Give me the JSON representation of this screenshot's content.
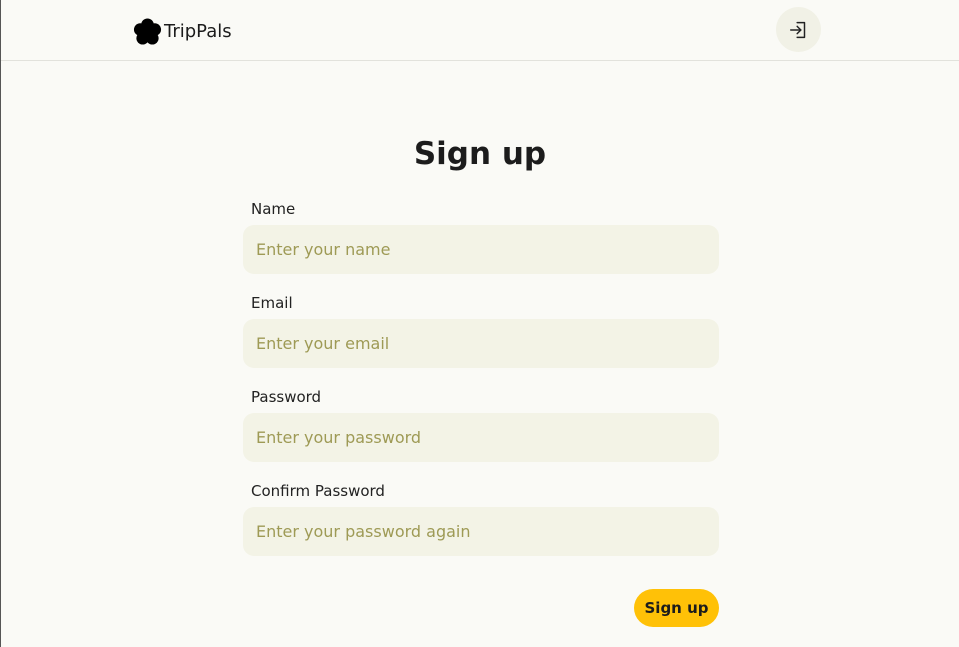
{
  "header": {
    "brand_name": "TripPals",
    "logo_icon": "flower-icon",
    "login_icon": "login-icon"
  },
  "form": {
    "title": "Sign up",
    "fields": [
      {
        "label": "Name",
        "placeholder": "Enter your name",
        "value": ""
      },
      {
        "label": "Email",
        "placeholder": "Enter your email",
        "value": ""
      },
      {
        "label": "Password",
        "placeholder": "Enter your password",
        "value": ""
      },
      {
        "label": "Confirm Password",
        "placeholder": "Enter your password again",
        "value": ""
      }
    ],
    "submit_label": "Sign up"
  },
  "colors": {
    "background": "#fafaf6",
    "input_background": "#f3f3e6",
    "placeholder": "#9e9a55",
    "accent": "#ffc107"
  }
}
